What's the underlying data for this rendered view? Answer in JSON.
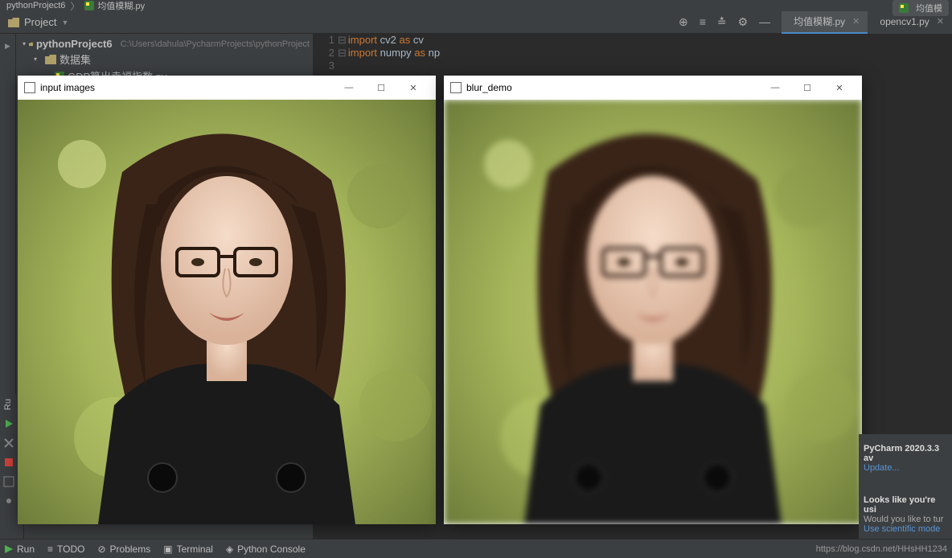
{
  "breadcrumb": {
    "project": "pythonProject6",
    "file": "均值模糊.py"
  },
  "runconfig": {
    "label": "均值模"
  },
  "project_dropdown": {
    "label": "Project"
  },
  "tree": {
    "root": {
      "name": "pythonProject6",
      "hint": "C:\\Users\\dahula\\PycharmProjects\\pythonProject"
    },
    "folder1": {
      "name": "数据集"
    },
    "file1": {
      "name": "GDP算出幸福指数.py"
    }
  },
  "tabs": [
    {
      "label": "均值模糊.py",
      "active": true
    },
    {
      "label": "opencv1.py",
      "active": false
    }
  ],
  "code": {
    "lines": [
      {
        "n": "1",
        "kw1": "import",
        "id1": "cv2",
        "kw2": "as",
        "id2": "cv"
      },
      {
        "n": "2",
        "kw1": "import",
        "id1": "numpy",
        "kw2": "as",
        "id2": "np"
      },
      {
        "n": "3",
        "kw1": "",
        "id1": "",
        "kw2": "",
        "id2": ""
      }
    ]
  },
  "windows": {
    "input": {
      "title": "input images"
    },
    "blur": {
      "title": "blur_demo"
    }
  },
  "winctrls": {
    "min": "—",
    "max": "☐",
    "close": "✕"
  },
  "notifications": {
    "n1": {
      "title": "PyCharm 2020.3.3 av",
      "link": "Update..."
    },
    "n2": {
      "title": "Looks like you're usi",
      "text": "Would you like to tur",
      "link": "Use scientific mode"
    }
  },
  "bottom": {
    "run": "Run",
    "todo": "TODO",
    "problems": "Problems",
    "terminal": "Terminal",
    "pyconsole": "Python Console",
    "url": "https://blog.csdn.net/HHsHH1234"
  },
  "runlabel": "Ru"
}
